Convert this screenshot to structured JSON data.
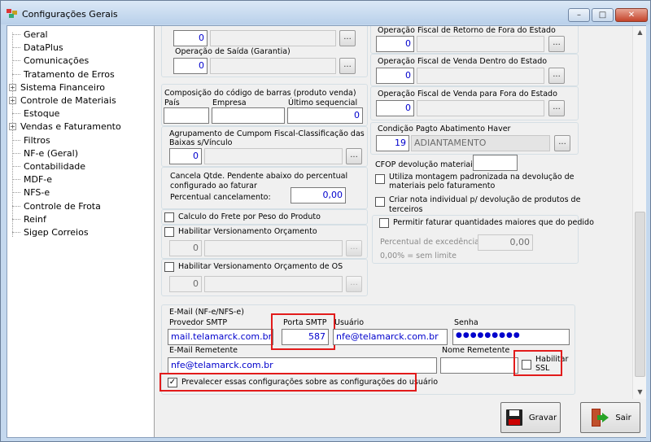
{
  "window": {
    "title": "Configurações Gerais",
    "minimize": "–",
    "maximize": "□",
    "close": "✕"
  },
  "tree": {
    "items": [
      {
        "label": "Geral",
        "expandable": false
      },
      {
        "label": "DataPlus",
        "expandable": false
      },
      {
        "label": "Comunicações",
        "expandable": false
      },
      {
        "label": "Tratamento de Erros",
        "expandable": false
      },
      {
        "label": "Sistema Financeiro",
        "expandable": true
      },
      {
        "label": "Controle de Materiais",
        "expandable": true
      },
      {
        "label": "Estoque",
        "expandable": false
      },
      {
        "label": "Vendas e Faturamento",
        "expandable": true
      },
      {
        "label": "Filtros",
        "expandable": false
      },
      {
        "label": "NF-e (Geral)",
        "expandable": false
      },
      {
        "label": "Contabilidade",
        "expandable": false
      },
      {
        "label": "MDF-e",
        "expandable": false
      },
      {
        "label": "NFS-e",
        "expandable": false
      },
      {
        "label": "Controle de Frota",
        "expandable": false
      },
      {
        "label": "Reinf",
        "expandable": false
      },
      {
        "label": "Sigep Correios",
        "expandable": false
      }
    ]
  },
  "left": {
    "op1_value": "0",
    "op_saida_label": "Operação de Saída (Garantia)",
    "op_saida_value": "0",
    "barcode_group_label": "Composição do código de barras (produto venda)",
    "pais_label": "País",
    "empresa_label": "Empresa",
    "ultimo_label": "Último sequencial",
    "ultimo_value": "0",
    "agrup_label1": "Agrupamento de Cumpom Fiscal-Classificação das",
    "agrup_label2": "Baixas s/Vínculo",
    "agrup_value": "0",
    "cancela_label1": "Cancela Qtde. Pendente abaixo do percentual",
    "cancela_label2": "configurado ao faturar",
    "percentual_label": "Percentual cancelamento:",
    "percentual_value": "0,00",
    "frete_label": "Calculo do Frete por Peso do Produto",
    "versionamento_label": "Habilitar Versionamento Orçamento",
    "versionamento_value": "0",
    "versionamento_os_label": "Habilitar Versionamento Orçamento de OS",
    "versionamento_os_value": "0"
  },
  "right": {
    "retorno_label": "Operação Fiscal de Retorno de Fora do Estado",
    "retorno_value": "0",
    "venda_dentro_label": "Operação Fiscal de Venda Dentro do Estado",
    "venda_dentro_value": "0",
    "venda_fora_label": "Operação Fiscal de Venda para Fora do Estado",
    "venda_fora_value": "0",
    "condicao_label": "Condição Pagto Abatimento Haver",
    "condicao_code": "19",
    "condicao_desc": "ADIANTAMENTO",
    "cfop_label": "CFOP devolução materiais:",
    "montagem_label1": "Utiliza montagem padronizada na devolução de",
    "montagem_label2": "materiais pelo faturamento",
    "nota_label1": "Criar nota individual p/ devolução de produtos de",
    "nota_label2": "terceiros",
    "permitir_label": "Permitir faturar quantidades maiores que do pedido",
    "excedencia_label": "Percentual de excedência:",
    "excedencia_value": "0,00",
    "sem_limite": "0,00% = sem limite"
  },
  "email": {
    "group_label": "E-Mail (NF-e/NFS-e)",
    "provedor_label": "Provedor SMTP",
    "provedor_value": "mail.telamarck.com.br",
    "porta_label": "Porta SMTP",
    "porta_value": "587",
    "usuario_label": "Usuário",
    "usuario_value": "nfe@telamarck.com.br",
    "senha_label": "Senha",
    "senha_value": "●●●●●●●●●",
    "remetente_label": "E-Mail Remetente",
    "remetente_value": "nfe@telamarck.com.br",
    "nome_remetente_label": "Nome Remetente",
    "ssl_label1": "Habilitar",
    "ssl_label2": "SSL",
    "prevalecer_label": "Prevalecer essas configurações sobre as configurações do usuário",
    "prevalecer_checked": "✓"
  },
  "buttons": {
    "gravar": "Gravar",
    "sair": "Sair"
  },
  "dots_glyph": "...",
  "colors": {
    "highlight": "#e21b1b",
    "value_text": "#0000cc"
  }
}
